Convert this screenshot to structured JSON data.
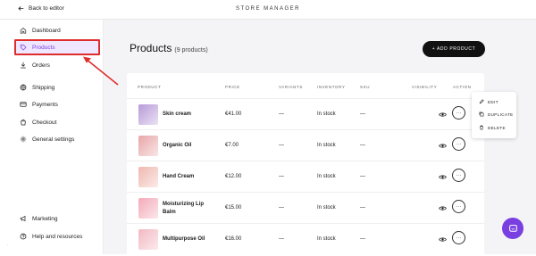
{
  "header": {
    "back_label": "Back to editor",
    "title": "STORE MANAGER"
  },
  "sidebar": {
    "items": [
      {
        "label": "Dashboard",
        "icon": "home-icon"
      },
      {
        "label": "Products",
        "icon": "tag-icon",
        "active": true
      },
      {
        "label": "Orders",
        "icon": "download-icon"
      },
      {
        "label": "Shipping",
        "icon": "globe-icon"
      },
      {
        "label": "Payments",
        "icon": "card-icon"
      },
      {
        "label": "Checkout",
        "icon": "bag-icon"
      },
      {
        "label": "General settings",
        "icon": "gear-icon"
      },
      {
        "label": "Marketing",
        "icon": "megaphone-icon"
      },
      {
        "label": "Help and resources",
        "icon": "help-icon"
      }
    ]
  },
  "main": {
    "title": "Products",
    "count_label": "(9 products)",
    "add_button": "+ ADD PRODUCT",
    "columns": [
      "PRODUCT",
      "PRICE",
      "VARIANTS",
      "INVENTORY",
      "SKU",
      "VISIBILITY",
      "ACTION"
    ],
    "rows": [
      {
        "name": "Skin cream",
        "price": "€41.00",
        "variants": "—",
        "inventory": "In stock",
        "sku": "—",
        "thumb_color": "#b89ad8"
      },
      {
        "name": "Organic Oil",
        "price": "€7.00",
        "variants": "—",
        "inventory": "In stock",
        "sku": "—",
        "thumb_color": "#e8a6a8"
      },
      {
        "name": "Hand Cream",
        "price": "€12.00",
        "variants": "—",
        "inventory": "In stock",
        "sku": "—",
        "thumb_color": "#f0b8b0"
      },
      {
        "name": "Moisturizing Lip Balm",
        "price": "€15.00",
        "variants": "—",
        "inventory": "In stock",
        "sku": "—",
        "thumb_color": "#f3aab8"
      },
      {
        "name": "Multipurpose Oil",
        "price": "€16.00",
        "variants": "—",
        "inventory": "In stock",
        "sku": "—",
        "thumb_color": "#f2b8c2"
      }
    ],
    "action_symbol": "···"
  },
  "menu": {
    "edit": "EDIT",
    "duplicate": "DUPLICATE",
    "delete": "DELETE"
  },
  "colors": {
    "accent": "#7b3fe4",
    "highlight_border": "#e02b2b",
    "chat_button": "#7a3fe0"
  },
  "corner_mark": "·"
}
